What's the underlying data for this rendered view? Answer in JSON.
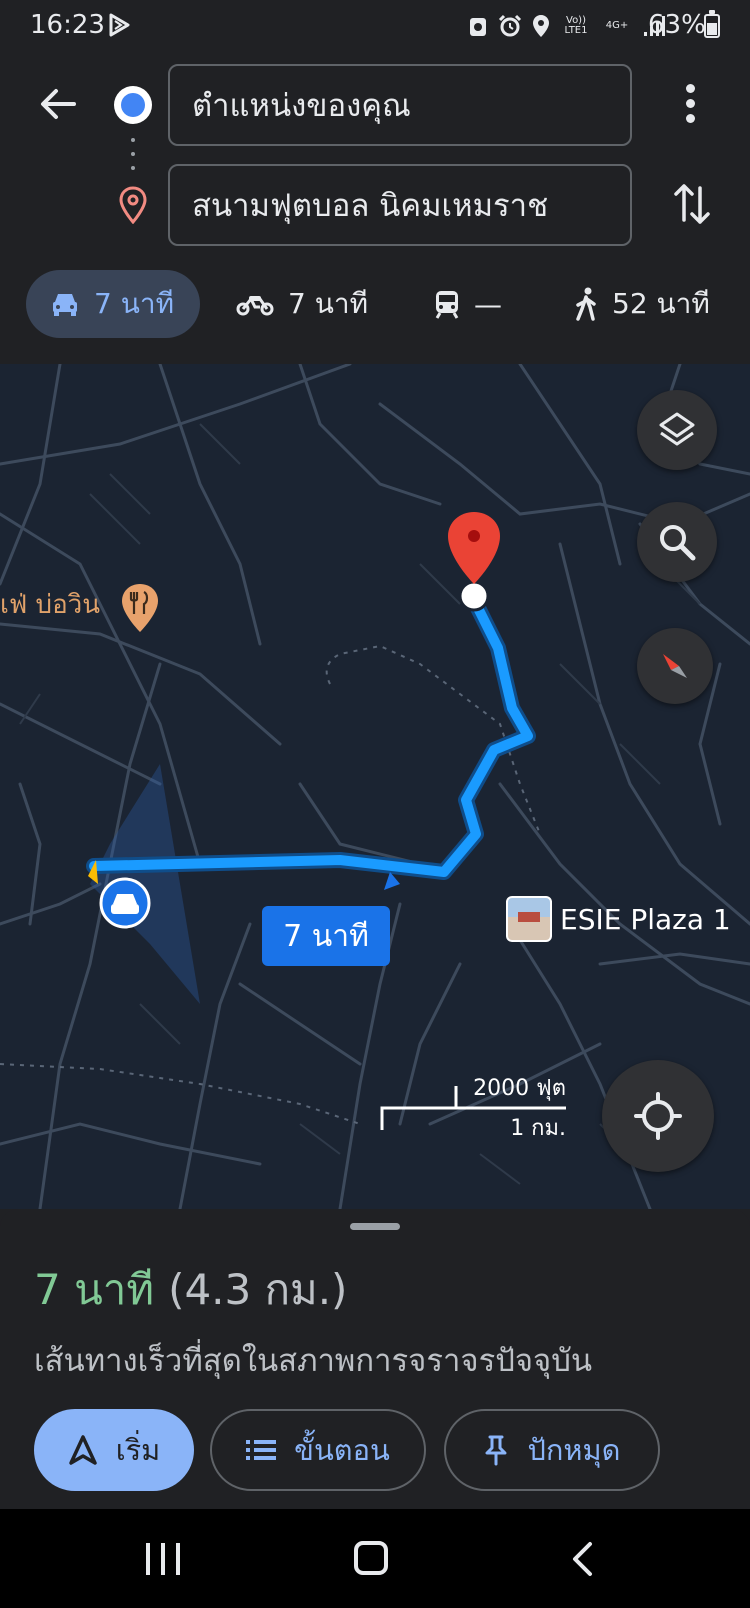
{
  "status_bar": {
    "time": "16:23",
    "network": "Vo)) LTE1",
    "data": "4G+",
    "battery": "63%",
    "icons": [
      "play-icon",
      "recycle-icon",
      "alarm-icon",
      "location-icon",
      "signal-icon",
      "battery-icon"
    ]
  },
  "header": {
    "origin": "ตำแหน่งของคุณ",
    "destination": "สนามฟุตบอล นิคมเหมราช",
    "modes": [
      {
        "name": "car",
        "label": "7 นาที",
        "active": true
      },
      {
        "name": "motorcycle",
        "label": "7 นาที",
        "active": false
      },
      {
        "name": "transit",
        "label": "—",
        "active": false
      },
      {
        "name": "walk",
        "label": "52 นาที",
        "active": false
      }
    ]
  },
  "map": {
    "poi_cafe": "เฟ่ บ่อวิน",
    "poi_esie": "ESIE Plaza 1",
    "eta_label": "7 นาที",
    "scale_imperial": "2000 ฟุต",
    "scale_metric": "1 กม.",
    "colors": {
      "route": "#1a9bff",
      "route_outline": "#1565c0",
      "background": "#1b2432",
      "roads": "#3d4a5c",
      "pin": "#ea4335"
    }
  },
  "sheet": {
    "duration": "7 นาที",
    "distance": "(4.3 กม.)",
    "description": "เส้นทางเร็วที่สุดในสภาพการจราจรปัจจุบัน",
    "start_label": "เริ่ม",
    "steps_label": "ขั้นตอน",
    "pin_label": "ปักหมุด"
  }
}
